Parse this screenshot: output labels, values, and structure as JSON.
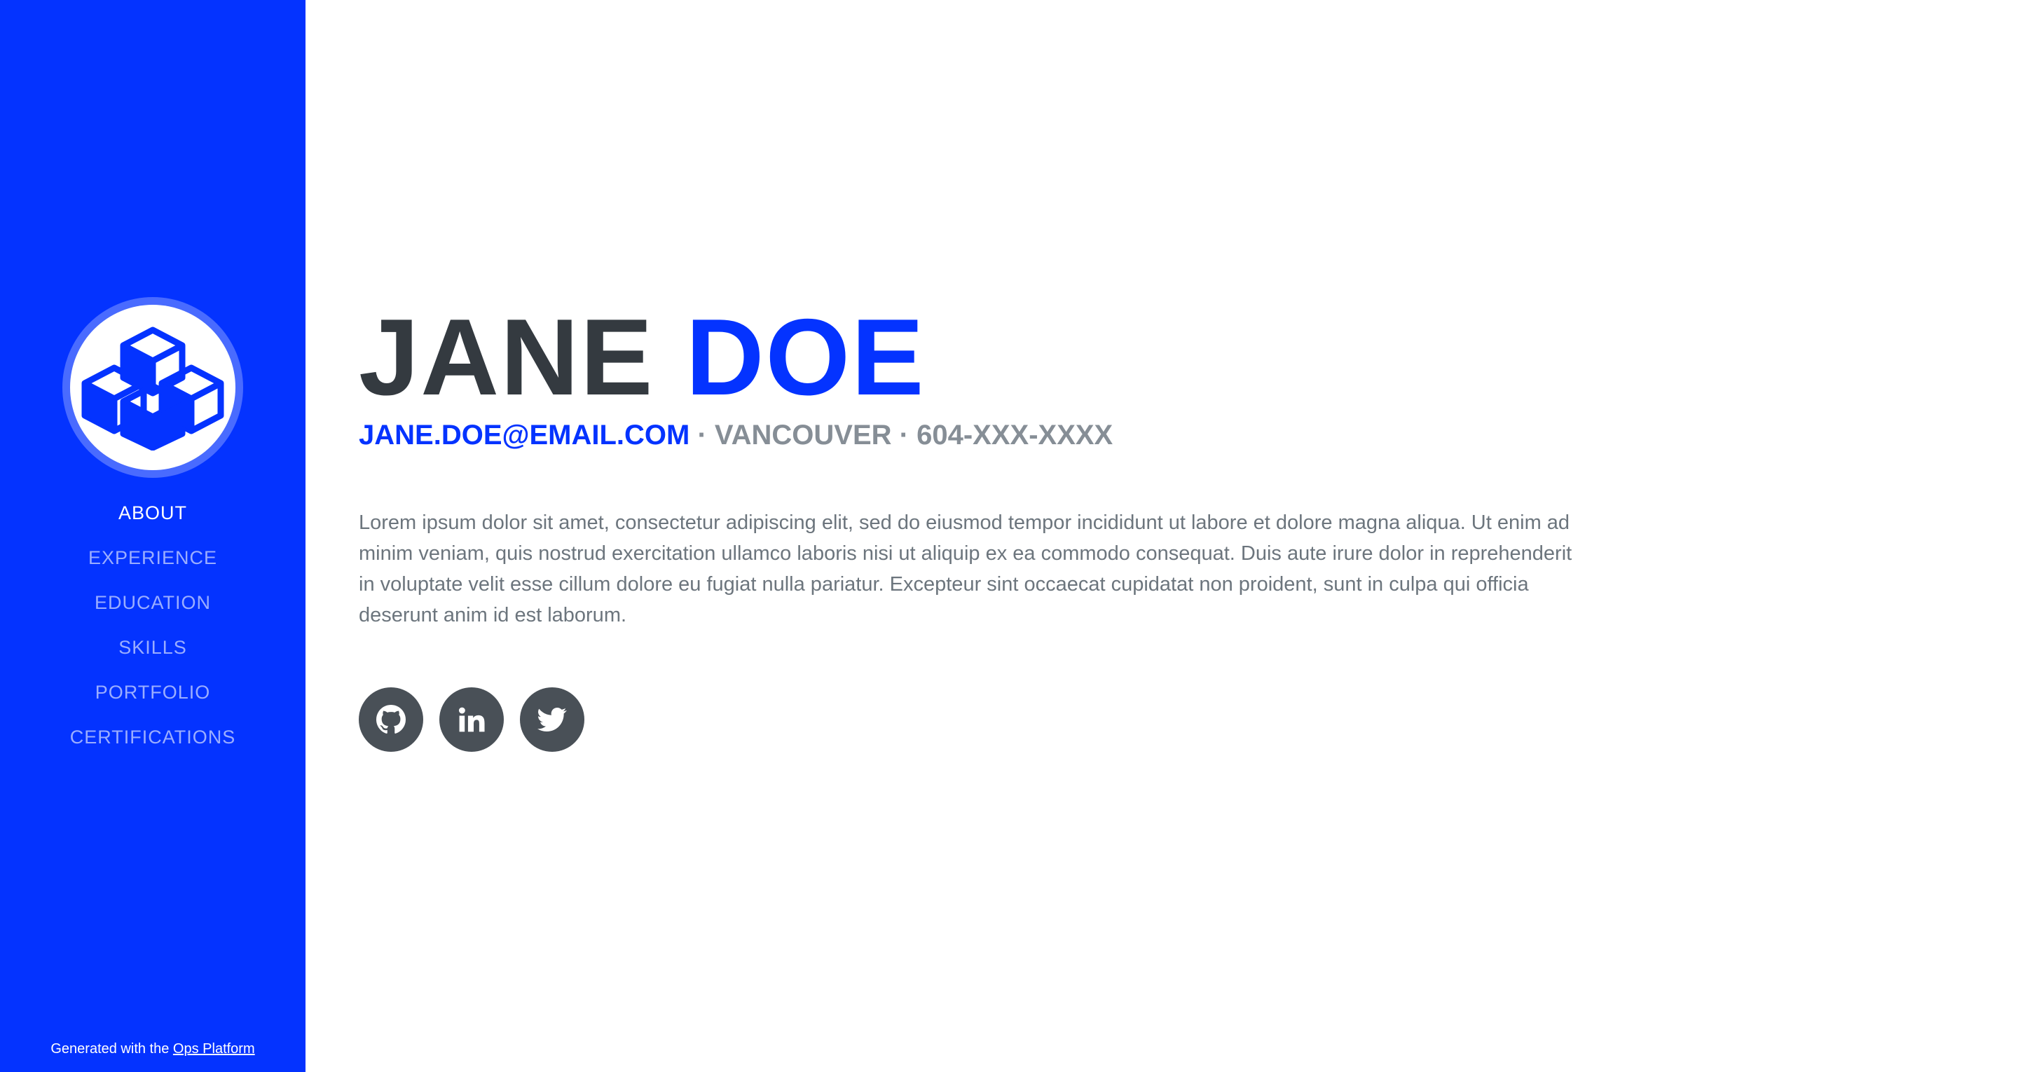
{
  "sidebar": {
    "logo_icon": "cubes-icon",
    "nav": [
      {
        "label": "ABOUT",
        "active": true
      },
      {
        "label": "EXPERIENCE"
      },
      {
        "label": "EDUCATION"
      },
      {
        "label": "SKILLS"
      },
      {
        "label": "PORTFOLIO"
      },
      {
        "label": "CERTIFICATIONS"
      }
    ],
    "footer": {
      "text": "Generated with the ",
      "link": "Ops Platform"
    }
  },
  "about": {
    "first_name": "JANE",
    "last_name": "DOE",
    "email": "JANE.DOE@EMAIL.COM",
    "separator": " · ",
    "city": "VANCOUVER",
    "phone": "604-XXX-XXXX",
    "bio": "Lorem ipsum dolor sit amet, consectetur adipiscing elit, sed do eiusmod tempor incididunt ut labore et dolore magna aliqua. Ut enim ad minim veniam, quis nostrud exercitation ullamco laboris nisi ut aliquip ex ea commodo consequat. Duis aute irure dolor in reprehenderit in voluptate velit esse cillum dolore eu fugiat nulla pariatur. Excepteur sint occaecat cupidatat non proident, sunt in culpa qui officia deserunt anim id est laborum.",
    "social": [
      {
        "icon": "github-icon"
      },
      {
        "icon": "linkedin-icon"
      },
      {
        "icon": "twitter-icon"
      }
    ]
  },
  "colors": {
    "primary": "#0433ff",
    "dark": "#343a40",
    "muted": "#868e96",
    "social_bg": "#495057"
  }
}
